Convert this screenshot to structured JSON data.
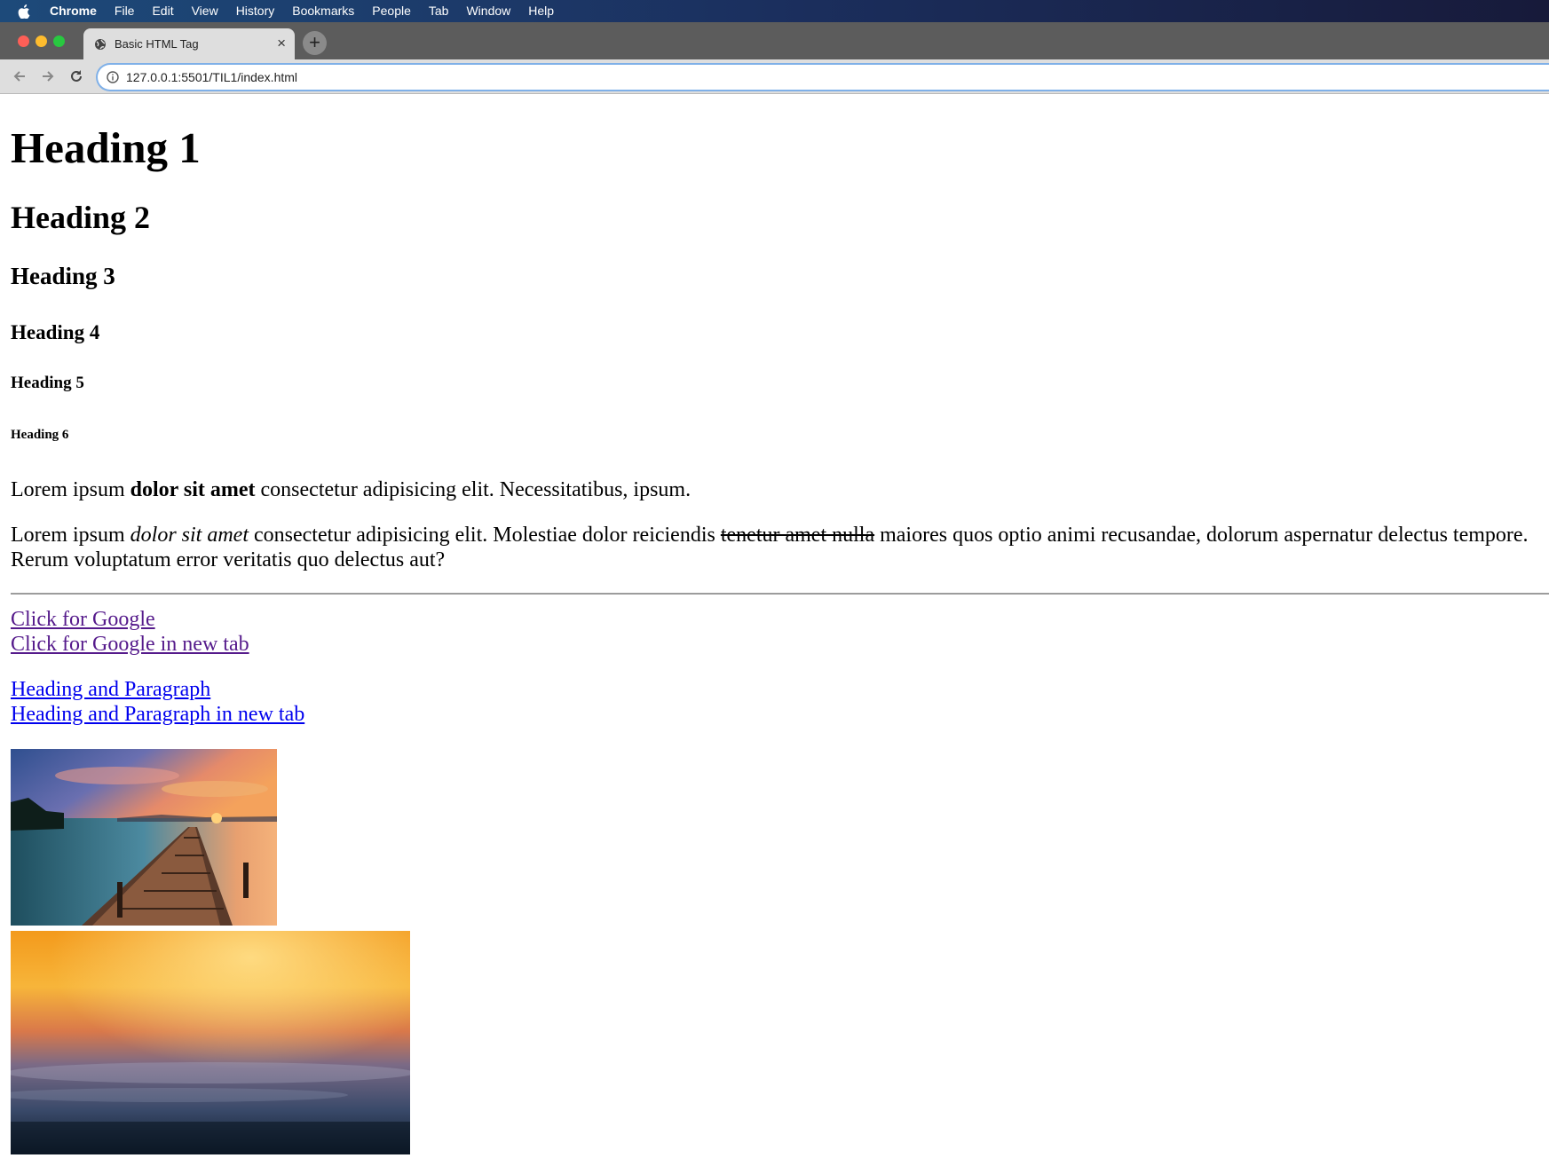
{
  "menubar": {
    "app": "Chrome",
    "items": [
      "File",
      "Edit",
      "View",
      "History",
      "Bookmarks",
      "People",
      "Tab",
      "Window",
      "Help"
    ]
  },
  "tab": {
    "title": "Basic HTML Tag"
  },
  "omnibox": {
    "url": "127.0.0.1:5501/TIL1/index.html"
  },
  "content": {
    "h1": "Heading 1",
    "h2": "Heading 2",
    "h3": "Heading 3",
    "h4": "Heading 4",
    "h5": "Heading 5",
    "h6": "Heading 6",
    "p1": {
      "before": "Lorem ipsum ",
      "bold": "dolor sit amet",
      "after": " consectetur adipisicing elit. Necessitatibus, ipsum."
    },
    "p2": {
      "before": "Lorem ipsum ",
      "italic": "dolor sit amet",
      "middle": " consectetur adipisicing elit. Molestiae dolor reiciendis ",
      "struck": "tenetur amet nulla",
      "after": " maiores quos optio animi recusandae, dolorum aspernatur delectus tempore. Rerum voluptatum error veritatis quo delectus aut?"
    },
    "links": {
      "google": "Click for Google",
      "google_new_tab": "Click for Google in new tab",
      "heading_paragraph": "Heading and Paragraph",
      "heading_paragraph_new_tab": "Heading and Paragraph in new tab"
    }
  }
}
